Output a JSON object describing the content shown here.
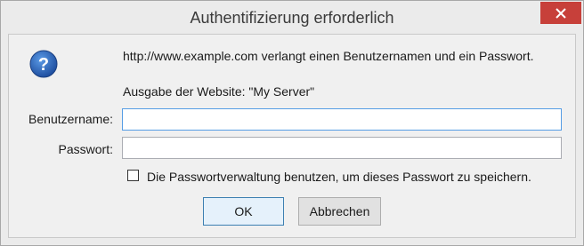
{
  "dialog": {
    "title": "Authentifizierung erforderlich",
    "close_icon": "close-icon",
    "info_icon": "question-icon",
    "message": "http://www.example.com verlangt einen Benutzernamen und ein Passwort.",
    "realm": "Ausgabe der Website: \"My Server\"",
    "username_label": "Benutzername:",
    "username_value": "",
    "password_label": "Passwort:",
    "password_value": "",
    "remember_label": "Die Passwortverwaltung benutzen, um dieses Passwort zu speichern.",
    "remember_checked": false,
    "ok_label": "OK",
    "cancel_label": "Abbrechen"
  },
  "colors": {
    "close_button": "#c7403a",
    "icon_blue": "#1f62b7",
    "focus_border": "#569de5"
  }
}
